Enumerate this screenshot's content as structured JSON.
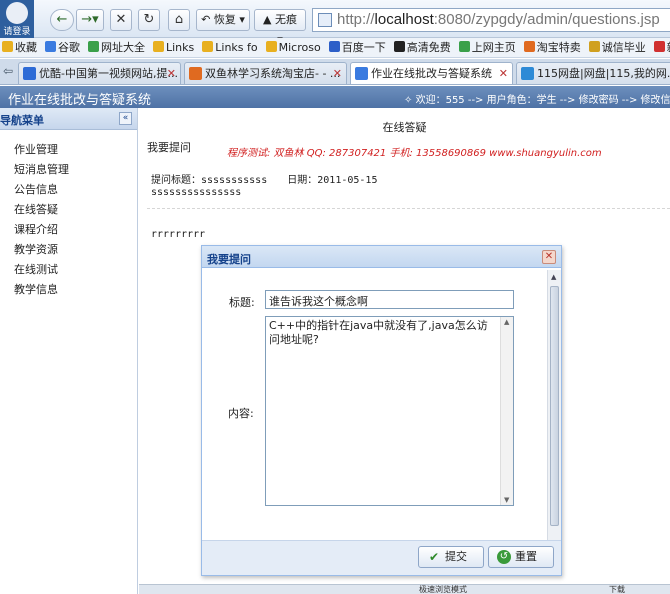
{
  "browser": {
    "login_label": "请登录",
    "back_icon": "back-arrow-icon",
    "forward_icon": "forward-arrow-icon",
    "restore_label": "恢复",
    "incognito_label": "无痕",
    "address": {
      "prefix": "http://",
      "host": "localhost",
      "rest": ":8080/zypgdy/admin/questions.jsp"
    },
    "bookmarks": [
      {
        "label": "收藏",
        "color": "#e8b020"
      },
      {
        "label": "谷歌",
        "color": "#3a7be0"
      },
      {
        "label": "网址大全",
        "color": "#3aa04a"
      },
      {
        "label": "Links",
        "color": "#e8b020"
      },
      {
        "label": "Links fo",
        "color": "#e8b020"
      },
      {
        "label": "Microso",
        "color": "#e8b020"
      },
      {
        "label": "百度一下",
        "color": "#2d5fc8"
      },
      {
        "label": "高清免费",
        "color": "#222222"
      },
      {
        "label": "上网主页",
        "color": "#3aa04a"
      },
      {
        "label": "淘宝特卖",
        "color": "#e06a20"
      },
      {
        "label": "诚信毕业",
        "color": "#d0a020"
      },
      {
        "label": "新浪",
        "color": "#d03030"
      }
    ],
    "tabs": [
      {
        "label": "优酷-中国第一视频网站,提...",
        "color": "#2d6bd6"
      },
      {
        "label": "双鱼林学习系统淘宝店- - ...",
        "color": "#e06a20"
      },
      {
        "label": "作业在线批改与答疑系统",
        "color": "#3a7be0"
      },
      {
        "label": "115网盘|网盘|115,我的网...",
        "color": "#2d8ad6"
      }
    ]
  },
  "app": {
    "title": "作业在线批改与答疑系统",
    "welcome": "欢迎：555 --> 用户角色：学生 --> 修改密码 --> 修改信"
  },
  "sidebar": {
    "title": "导航菜单",
    "collapse_icon": "«",
    "items": [
      "作业管理",
      "短消息管理",
      "公告信息",
      "在线答疑",
      "课程介绍",
      "教学资源",
      "在线测试",
      "教学信息"
    ]
  },
  "main": {
    "title": "在线答疑",
    "my_question": "我要提问",
    "promo": "程序测试: 双鱼林  QQ: 287307421  手机: 13558690869  www.shuangyulin.com",
    "question_title_label": "提问标题：",
    "question_title": "sssssssssss",
    "date_label": "日期：",
    "date": "2011-05-15",
    "question_title_cont": "sssssssssssssss",
    "answer": "rrrrrrrrr"
  },
  "dialog": {
    "title": "我要提问",
    "title_label": "标题:",
    "title_value": "谁告诉我这个概念啊",
    "content_label": "内容:",
    "content_value": "C++中的指针在java中就没有了,java怎么访问地址呢?",
    "submit_label": "提交",
    "reset_label": "重置"
  },
  "statusbar": {
    "mode": "极速浏览模式",
    "download": "下载"
  }
}
